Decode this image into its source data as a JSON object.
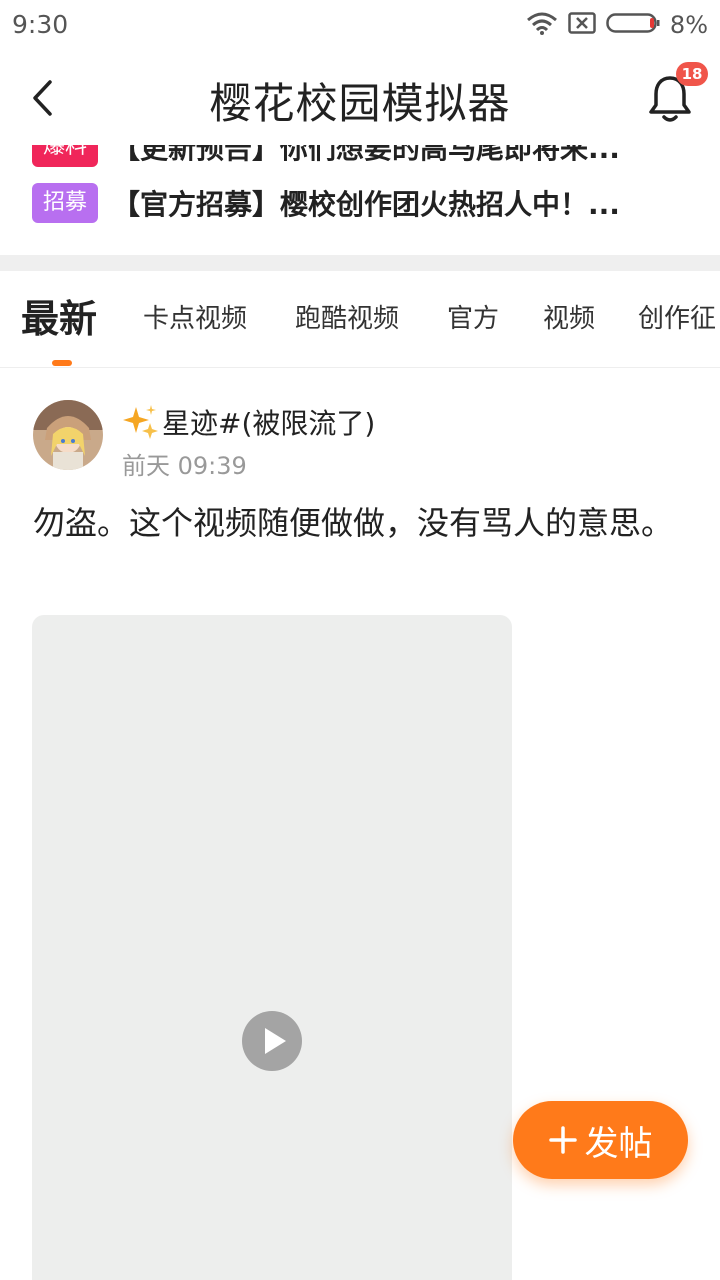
{
  "status_bar": {
    "time": "9:30",
    "battery_percent": "8%",
    "icons": [
      "wifi-icon",
      "no-sim-icon",
      "battery-icon"
    ]
  },
  "header": {
    "title": "樱花校园模拟器",
    "notification_count": "18",
    "icons": [
      "back-arrow-icon",
      "bell-icon"
    ]
  },
  "announcements": [
    {
      "tag": "爆料",
      "tag_color": "#f0265a",
      "text": "【更新预告】你们想要的高马尾即将来..."
    },
    {
      "tag": "招募",
      "tag_color": "#b86ff0",
      "text": "【官方招募】樱校创作团火热招人中！..."
    }
  ],
  "tabs": [
    {
      "label": "最新",
      "active": true
    },
    {
      "label": "卡点视频",
      "active": false
    },
    {
      "label": "跑酷视频",
      "active": false
    },
    {
      "label": "官方",
      "active": false
    },
    {
      "label": "视频",
      "active": false
    },
    {
      "label": "创作征",
      "active": false
    }
  ],
  "post": {
    "username": "星迹#(被限流了)",
    "time": "前天 09:39",
    "text": "勿盗。这个视频随便做做，没有骂人的意思。",
    "media_type": "video"
  },
  "fab": {
    "label": "发帖"
  },
  "colors": {
    "accent": "#ff7a1a",
    "badge": "#f0554a",
    "video_placeholder": "#edeeed"
  }
}
